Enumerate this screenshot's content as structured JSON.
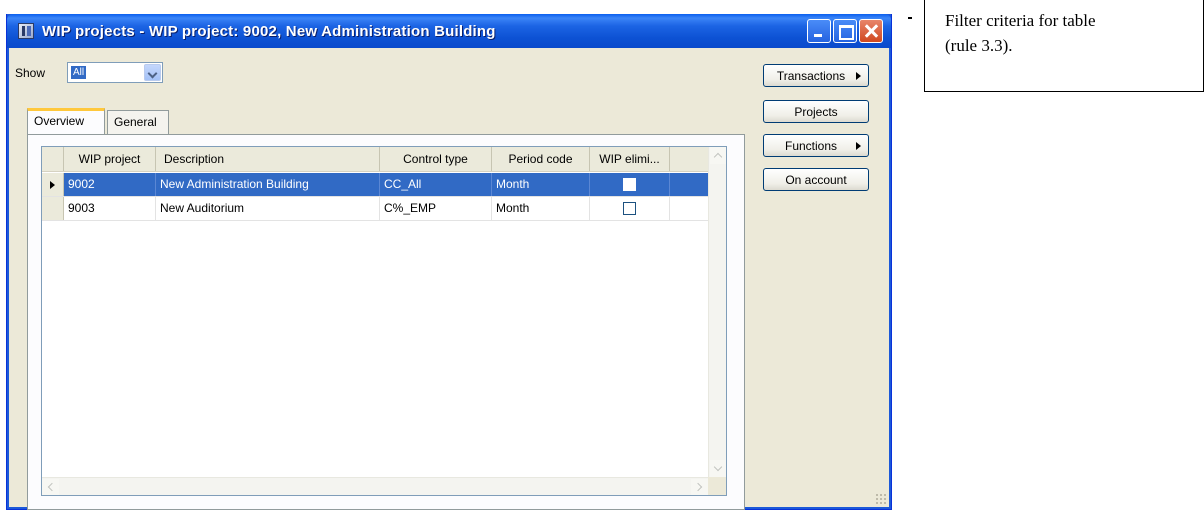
{
  "window": {
    "title": "WIP projects - WIP project: 9002, New Administration Building"
  },
  "filter": {
    "label": "Show",
    "value": "All"
  },
  "tabs": [
    {
      "label": "Overview",
      "active": true
    },
    {
      "label": "General",
      "active": false
    }
  ],
  "table": {
    "columns": [
      "WIP project",
      "Description",
      "Control type",
      "Period code",
      "WIP elimi..."
    ],
    "rows": [
      {
        "wip_project": "9002",
        "description": "New Administration Building",
        "control_type": "CC_All",
        "period_code": "Month",
        "wip_elim": false,
        "selected": true
      },
      {
        "wip_project": "9003",
        "description": "New Auditorium",
        "control_type": "C%_EMP",
        "period_code": "Month",
        "wip_elim": false,
        "selected": false
      }
    ]
  },
  "buttons": {
    "transactions": "Transactions",
    "projects": "Projects",
    "functions": "Functions",
    "on_account": "On account"
  },
  "annotation": {
    "line1": "Filter criteria for table",
    "line2": "(rule 3.3)."
  },
  "colors": {
    "titlebar": "#0a4acc",
    "selection": "#316ac5",
    "window_bg": "#ece9d8"
  }
}
